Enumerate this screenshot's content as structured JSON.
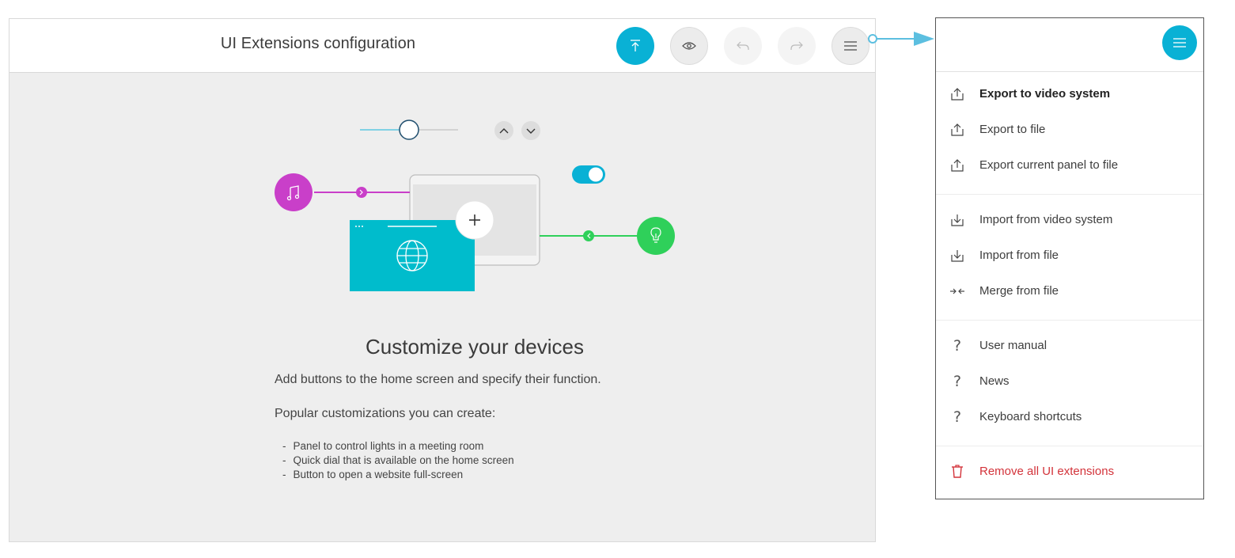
{
  "editor": {
    "title": "UI Extensions configuration",
    "toolbar": {
      "upload_icon": "upload-icon",
      "preview_icon": "eye-icon",
      "undo_icon": "undo-icon",
      "redo_icon": "redo-icon",
      "menu_icon": "hamburger-icon"
    },
    "empty_state": {
      "heading": "Customize your devices",
      "description": "Add buttons to the home screen and specify their function.",
      "popular_label": "Popular customizations you can create:",
      "examples": [
        "Panel to control lights in a meeting room",
        "Quick dial that is available on the home screen",
        "Button to open a website full-screen"
      ]
    }
  },
  "menu": {
    "groups": [
      {
        "items": [
          {
            "label": "Export to video system",
            "icon": "export-icon",
            "primary": true
          },
          {
            "label": "Export to file",
            "icon": "export-icon"
          },
          {
            "label": "Export current panel to file",
            "icon": "export-icon"
          }
        ]
      },
      {
        "items": [
          {
            "label": "Import from video system",
            "icon": "import-icon"
          },
          {
            "label": "Import from file",
            "icon": "import-icon"
          },
          {
            "label": "Merge from file",
            "icon": "merge-icon"
          }
        ]
      },
      {
        "items": [
          {
            "label": "User manual",
            "icon": "help-icon"
          },
          {
            "label": "News",
            "icon": "help-icon"
          },
          {
            "label": "Keyboard shortcuts",
            "icon": "help-icon"
          }
        ]
      },
      {
        "items": [
          {
            "label": "Remove all UI extensions",
            "icon": "trash-icon",
            "danger": true
          }
        ]
      }
    ]
  },
  "colors": {
    "accent": "#09b1d5",
    "danger": "#d3333a",
    "music": "#c93fc9",
    "lightbulb": "#2fd05a",
    "web": "#00bccc"
  }
}
